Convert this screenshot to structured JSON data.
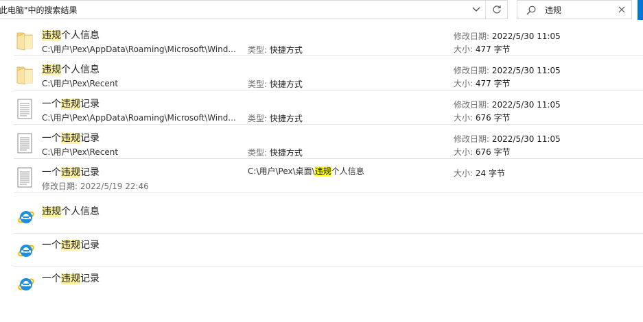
{
  "address_bar": {
    "text": "此电脑\"中的搜索结果"
  },
  "search": {
    "query": "违规"
  },
  "results": [
    {
      "kind": "folder",
      "name_pre": "",
      "name_hit": "违规",
      "name_post": "个人信息",
      "path": "C:\\用户\\Pex\\AppData\\Roaming\\Microsoft\\Wind...",
      "type_key": "类型:",
      "type_val": "快捷方式",
      "modified_key": "修改日期:",
      "modified_val": "2022/5/30 11:05",
      "size_key": "大小:",
      "size_val": "477 字节"
    },
    {
      "kind": "folder",
      "name_pre": "",
      "name_hit": "违规",
      "name_post": "个人信息",
      "path": "C:\\用户\\Pex\\Recent",
      "type_key": "类型:",
      "type_val": "快捷方式",
      "modified_key": "修改日期:",
      "modified_val": "2022/5/30 11:05",
      "size_key": "大小:",
      "size_val": "477 字节"
    },
    {
      "kind": "doc",
      "name_pre": "一个",
      "name_hit": "违规",
      "name_post": "记录",
      "path": "C:\\用户\\Pex\\AppData\\Roaming\\Microsoft\\Wind...",
      "type_key": "类型:",
      "type_val": "快捷方式",
      "modified_key": "修改日期:",
      "modified_val": "2022/5/30 11:05",
      "size_key": "大小:",
      "size_val": "676 字节"
    },
    {
      "kind": "doc",
      "name_pre": "一个",
      "name_hit": "违规",
      "name_post": "记录",
      "path": "C:\\用户\\Pex\\Recent",
      "type_key": "类型:",
      "type_val": "快捷方式",
      "modified_key": "修改日期:",
      "modified_val": "2022/5/30 11:05",
      "size_key": "大小:",
      "size_val": "676 字节"
    },
    {
      "kind": "doc",
      "name_pre": "一个",
      "name_hit": "违规",
      "name_post": "记录",
      "modified_line": "修改日期:  2022/5/19 22:46",
      "loc_pre": "C:\\用户\\Pex\\桌面\\",
      "loc_hit": "违规",
      "loc_post": "个人信息",
      "size_key": "大小:",
      "size_val": "24 字节"
    },
    {
      "kind": "ie",
      "name_pre": "",
      "name_hit": "违规",
      "name_post": "个人信息"
    },
    {
      "kind": "ie",
      "name_pre": "一个",
      "name_hit": "违规",
      "name_post": "记录"
    },
    {
      "kind": "ie",
      "name_pre": "一个",
      "name_hit": "违规",
      "name_post": "记录"
    }
  ],
  "icons": {
    "folder": "folder-icon",
    "doc": "document-icon",
    "ie": "internet-explorer-icon",
    "search": "search-icon",
    "clear": "close-icon",
    "refresh": "refresh-icon",
    "dropdown": "chevron-down-icon"
  },
  "colors": {
    "highlight": "#fff3a0",
    "accent": "#0078d7",
    "ie_blue": "#1e8fe0",
    "ie_ring": "#f5b800"
  }
}
